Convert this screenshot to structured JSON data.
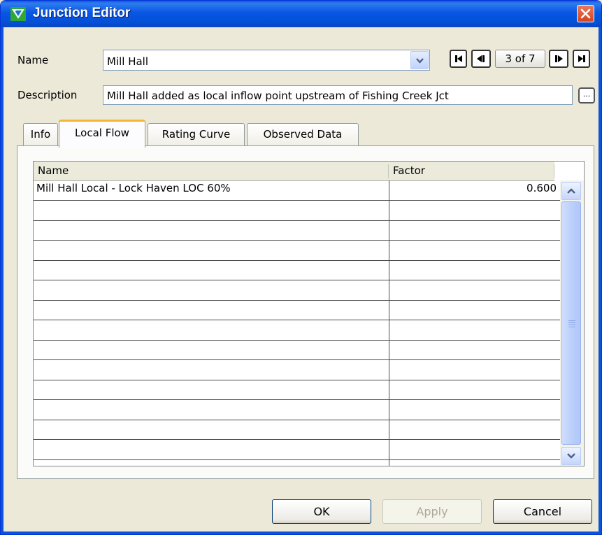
{
  "window": {
    "title": "Junction Editor",
    "icon": "junction-editor-icon",
    "close_icon": "close-icon"
  },
  "name_field": {
    "label": "Name",
    "value": "Mill Hall",
    "dropdown_icon": "chevron-down-icon"
  },
  "navigator": {
    "first_icon": "first-record-icon",
    "prev_icon": "previous-record-icon",
    "position": "3 of 7",
    "next_icon": "next-record-icon",
    "last_icon": "last-record-icon"
  },
  "description_field": {
    "label": "Description",
    "value": "Mill Hall added as local inflow point upstream of Fishing Creek Jct",
    "ellipsis": "..."
  },
  "tabs": [
    {
      "label": "Info",
      "active": false
    },
    {
      "label": "Local Flow",
      "active": true
    },
    {
      "label": "Rating Curve",
      "active": false
    },
    {
      "label": "Observed Data",
      "active": false
    }
  ],
  "local_flow_table": {
    "columns": [
      "Name",
      "Factor"
    ],
    "rows": [
      {
        "name": "Mill Hall Local - Lock Haven LOC 60%",
        "factor": "0.600"
      },
      {
        "name": "",
        "factor": ""
      },
      {
        "name": "",
        "factor": ""
      },
      {
        "name": "",
        "factor": ""
      },
      {
        "name": "",
        "factor": ""
      },
      {
        "name": "",
        "factor": ""
      },
      {
        "name": "",
        "factor": ""
      },
      {
        "name": "",
        "factor": ""
      },
      {
        "name": "",
        "factor": ""
      },
      {
        "name": "",
        "factor": ""
      },
      {
        "name": "",
        "factor": ""
      },
      {
        "name": "",
        "factor": ""
      },
      {
        "name": "",
        "factor": ""
      },
      {
        "name": "",
        "factor": ""
      }
    ]
  },
  "buttons": {
    "ok": "OK",
    "apply": "Apply",
    "cancel": "Cancel"
  },
  "colors": {
    "title_bar": "#0856e3",
    "close_button": "#d2451e",
    "active_tab_accent": "#f3b734"
  }
}
